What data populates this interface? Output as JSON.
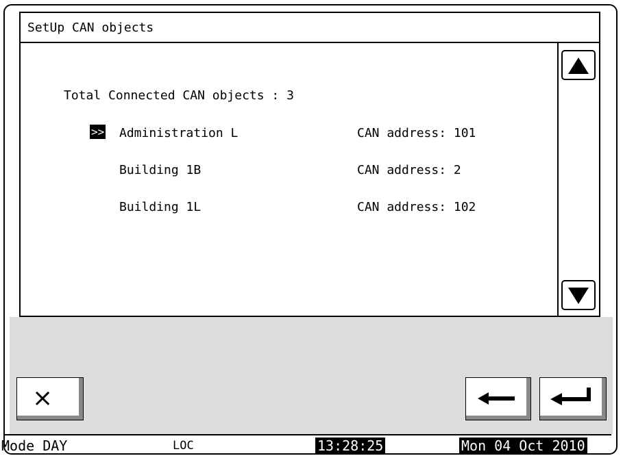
{
  "screen": {
    "title": "SetUp CAN objects"
  },
  "summary": {
    "label": "Total Connected CAN objects : 3"
  },
  "selector_marker": ">>",
  "objects": [
    {
      "name": "Administration L",
      "address": "CAN address: 101",
      "selected": true
    },
    {
      "name": "Building 1B",
      "address": "CAN address: 2",
      "selected": false
    },
    {
      "name": "Building 1L",
      "address": "CAN address: 102",
      "selected": false
    }
  ],
  "scroll": {
    "up_icon": "triangle-up",
    "down_icon": "triangle-down"
  },
  "buttons": {
    "cancel_icon": "×",
    "back_icon": "arrow-left",
    "enter_icon": "arrow-enter"
  },
  "status": {
    "mode": "Mode DAY",
    "loc": "LOC",
    "time": "13:28:25",
    "date": "Mon 04 Oct 2010"
  }
}
